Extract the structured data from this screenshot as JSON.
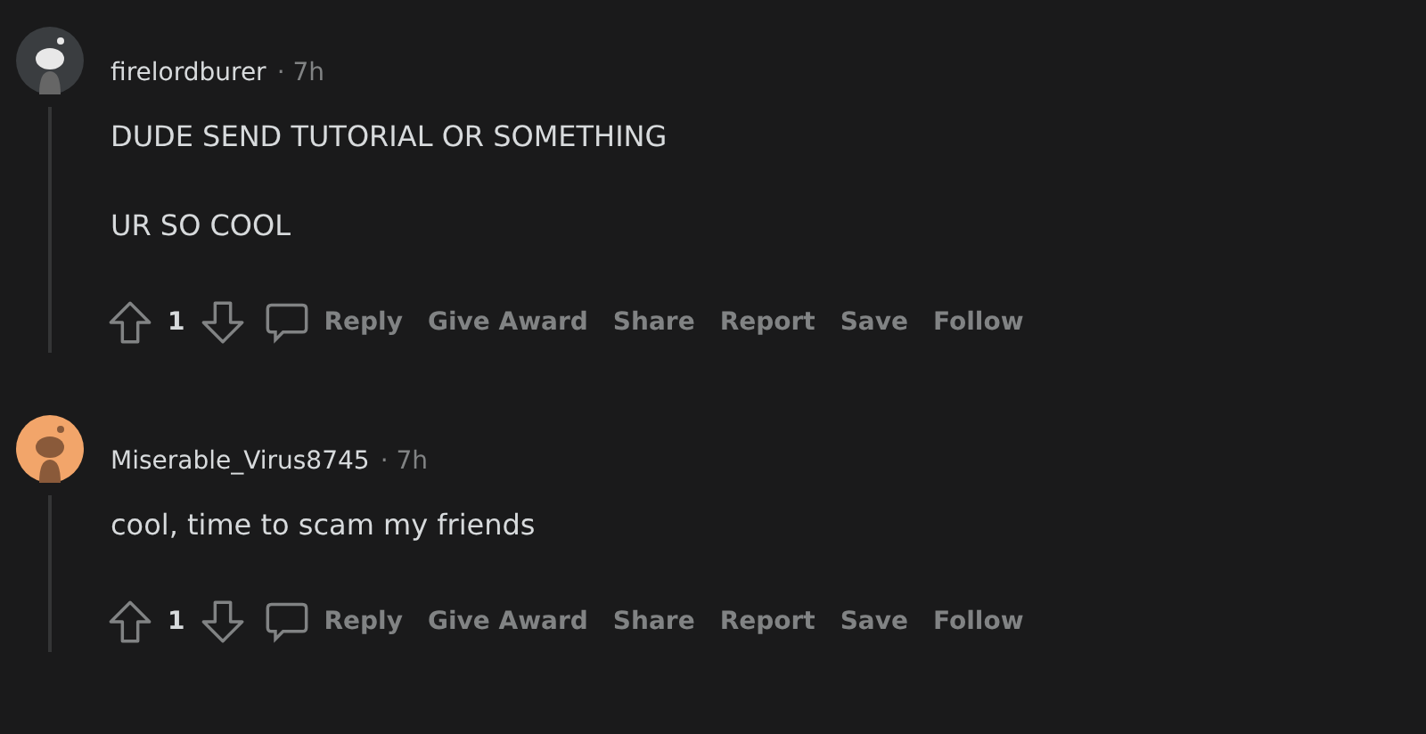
{
  "comments": [
    {
      "author": "firelordburer",
      "time": "· 7h",
      "color": "#3a3d40",
      "paragraphs": [
        "DUDE SEND TUTORIAL OR SOMETHING",
        "UR SO COOL"
      ],
      "score": "1",
      "actions": [
        "Reply",
        "Give Award",
        "Share",
        "Report",
        "Save",
        "Follow"
      ]
    },
    {
      "author": "Miserable_Virus8745",
      "time": "· 7h",
      "color": "#f2a56a",
      "paragraphs": [
        "cool, time to scam my friends"
      ],
      "score": "1",
      "actions": [
        "Reply",
        "Give Award",
        "Share",
        "Report",
        "Save",
        "Follow"
      ]
    }
  ]
}
